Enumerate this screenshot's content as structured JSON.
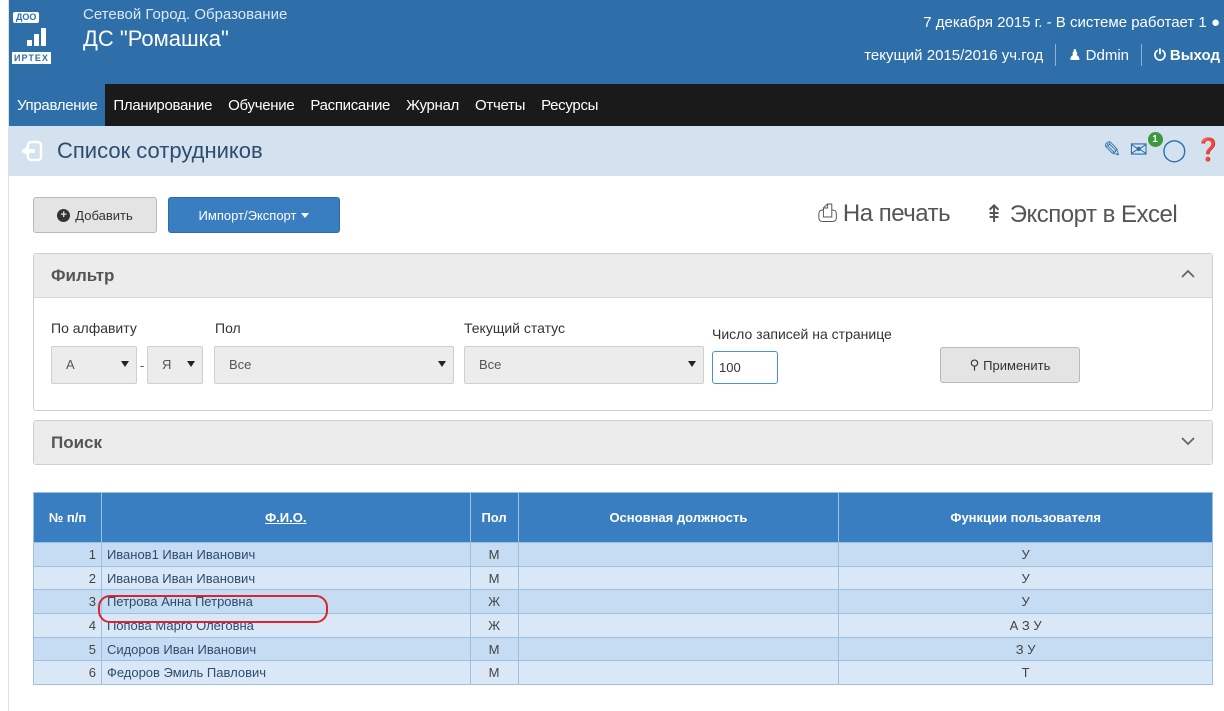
{
  "header": {
    "logo_badge": "ДОО",
    "logo_brand": "ИРТЕХ",
    "app_name": "Сетевой Город. Образование",
    "org_name": "ДС \"Ромашка\"",
    "date_status": "7 декабря 2015 г. - В системе работает 1",
    "school_year": "текущий 2015/2016 уч.год",
    "user": "Ddmin",
    "logout": "Выход"
  },
  "nav": {
    "items": [
      "Управление",
      "Планирование",
      "Обучение",
      "Расписание",
      "Журнал",
      "Отчеты",
      "Ресурсы"
    ],
    "active": 0
  },
  "page": {
    "title": "Список сотрудников",
    "notification_count": "1"
  },
  "toolbar": {
    "add_label": "Добавить",
    "import_label": "Импорт/Экспорт",
    "print_label": "На печать",
    "excel_label": "Экспорт в Excel"
  },
  "filter": {
    "title": "Фильтр",
    "alphabet_label": "По алфавиту",
    "alphabet_from": "А",
    "alphabet_to": "Я",
    "gender_label": "Пол",
    "gender_value": "Все",
    "status_label": "Текущий статус",
    "status_value": "Все",
    "per_page_label": "Число записей на странице",
    "per_page_value": "100",
    "apply_label": "Применить"
  },
  "search": {
    "title": "Поиск"
  },
  "table": {
    "headers": [
      "№ п/п",
      "Ф.И.О.",
      "Пол",
      "Основная должность",
      "Функции пользователя"
    ],
    "rows": [
      {
        "num": "1",
        "name": "Иванов1 Иван Иванович",
        "gender": "М",
        "position": "",
        "functions": "У"
      },
      {
        "num": "2",
        "name": "Иванова Иван Иванович",
        "gender": "М",
        "position": "",
        "functions": "У"
      },
      {
        "num": "3",
        "name": "Петрова Анна Петровна",
        "gender": "Ж",
        "position": "",
        "functions": "У"
      },
      {
        "num": "4",
        "name": "Попова Марго Олеговна",
        "gender": "Ж",
        "position": "",
        "functions": "А З У"
      },
      {
        "num": "5",
        "name": "Сидоров Иван Иванович",
        "gender": "М",
        "position": "",
        "functions": "З У"
      },
      {
        "num": "6",
        "name": "Федоров Эмиль Павлович",
        "gender": "М",
        "position": "",
        "functions": "Т"
      }
    ]
  },
  "colors": {
    "brand_blue": "#2e6faa",
    "nav_bg": "#1a1a1a",
    "highlight_red": "#d9262e"
  }
}
